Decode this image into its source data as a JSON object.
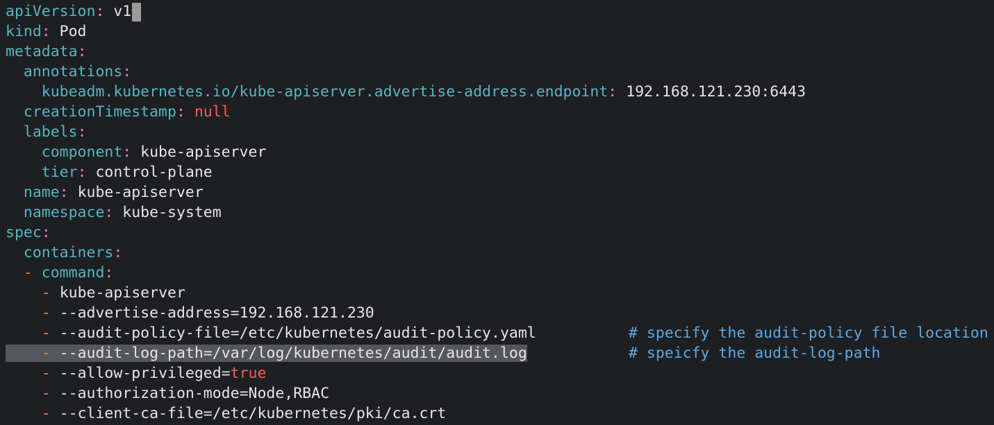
{
  "editor": {
    "colors": {
      "background": "#1e1f22",
      "key": "#56b6c2",
      "colon": "#ff79c6",
      "value": "#e6e6e6",
      "keyword": "#ff5c57",
      "dash": "#e68a2e",
      "comment": "#5aa9e6",
      "selection": "#55575c"
    },
    "lines": [
      {
        "indent": "",
        "key": "apiVersion",
        "value": "v1"
      },
      {
        "indent": "",
        "key": "kind",
        "value": "Pod"
      },
      {
        "indent": "",
        "key": "metadata",
        "value": ""
      },
      {
        "indent": "  ",
        "key": "annotations",
        "value": ""
      },
      {
        "indent": "    ",
        "key": "kubeadm.kubernetes.io/kube-apiserver.advertise-address.endpoint",
        "value": "192.168.121.230:6443"
      },
      {
        "indent": "  ",
        "key": "creationTimestamp",
        "value": "null"
      },
      {
        "indent": "  ",
        "key": "labels",
        "value": ""
      },
      {
        "indent": "    ",
        "key": "component",
        "value": "kube-apiserver"
      },
      {
        "indent": "    ",
        "key": "tier",
        "value": "control-plane"
      },
      {
        "indent": "  ",
        "key": "name",
        "value": "kube-apiserver"
      },
      {
        "indent": "  ",
        "key": "namespace",
        "value": "kube-system"
      },
      {
        "indent": "",
        "key": "spec",
        "value": ""
      },
      {
        "indent": "  ",
        "key": "containers",
        "value": ""
      },
      {
        "indent": "  ",
        "dash": "-",
        "key": "command",
        "value": ""
      },
      {
        "indent": "  ",
        "dash": "-",
        "value": "kube-apiserver"
      },
      {
        "indent": "  ",
        "dash": "-",
        "value": "--advertise-address=192.168.121.230"
      },
      {
        "indent": "  ",
        "dash": "-",
        "value": "--audit-policy-file=/etc/kubernetes/audit-policy.yaml",
        "comment": "# specify the audit-policy file location"
      },
      {
        "indent": "  ",
        "dash": "-",
        "value": "--audit-log-path=/var/log/kubernetes/audit/audit.log",
        "comment": "# speicfy the audit-log-path"
      },
      {
        "indent": "  ",
        "dash": "-",
        "value_prefix": "--allow-privileged=",
        "value_keyword": "true"
      },
      {
        "indent": "  ",
        "dash": "-",
        "value": "--authorization-mode=Node,RBAC"
      },
      {
        "indent": "  ",
        "dash": "-",
        "value": "--client-ca-file=/etc/kubernetes/pki/ca.crt"
      }
    ]
  }
}
